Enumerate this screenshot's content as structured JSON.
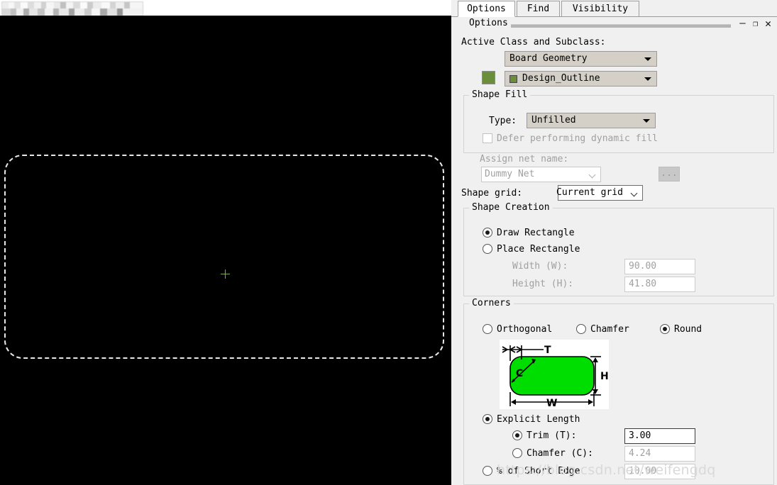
{
  "tabs": [
    {
      "id": "options",
      "label": "Options",
      "active": true
    },
    {
      "id": "find",
      "label": "Find",
      "active": false
    },
    {
      "id": "visibility",
      "label": "Visibility",
      "active": false
    }
  ],
  "titlebar": {
    "title": "Options",
    "minimize": "—",
    "maximize": "❐",
    "close": "✕"
  },
  "active_class": {
    "label": "Active Class and Subclass:",
    "class_value": "Board Geometry",
    "subclass_value": "Design_Outline",
    "swatch_color": "#6b8e3c"
  },
  "shape_fill": {
    "group_title": "Shape Fill",
    "type_label": "Type:",
    "type_value": "Unfilled",
    "defer_label": "Defer performing dynamic fill",
    "defer_checked": false
  },
  "net": {
    "assign_label": "Assign net name:",
    "net_value": "Dummy Net",
    "browse_label": "..."
  },
  "shape_grid": {
    "label": "Shape grid:",
    "value": "Current grid"
  },
  "shape_creation": {
    "group_title": "Shape Creation",
    "draw_rectangle": "Draw Rectangle",
    "place_rectangle": "Place Rectangle",
    "selected": "Draw Rectangle",
    "width_label": "Width (W):",
    "width_value": "90.00",
    "height_label": "Height (H):",
    "height_value": "41.80"
  },
  "corners": {
    "group_title": "Corners",
    "options": [
      "Orthogonal",
      "Chamfer",
      "Round"
    ],
    "selected": "Round",
    "diagram_labels": {
      "trim": "T",
      "chamfer": "C",
      "height": "H",
      "width": "W"
    },
    "diagram_fill": "#00dd00",
    "explicit_length_label": "Explicit Length",
    "explicit_length_selected": true,
    "trim_label": "Trim (T):",
    "trim_value": "3.00",
    "trim_selected": true,
    "chamfer_label": "Chamfer (C):",
    "chamfer_value": "4.24",
    "chamfer_selected": false,
    "percent_short_edge_label": "% of Short Edge",
    "percent_short_edge_value": "10.00",
    "percent_short_edge_selected": false
  },
  "canvas": {
    "outline_color": "#e8e8e8",
    "background": "#000000",
    "origin_marker": "crosshair"
  },
  "watermark": {
    "text": "https://blog.csdn.net/weifengdq"
  }
}
